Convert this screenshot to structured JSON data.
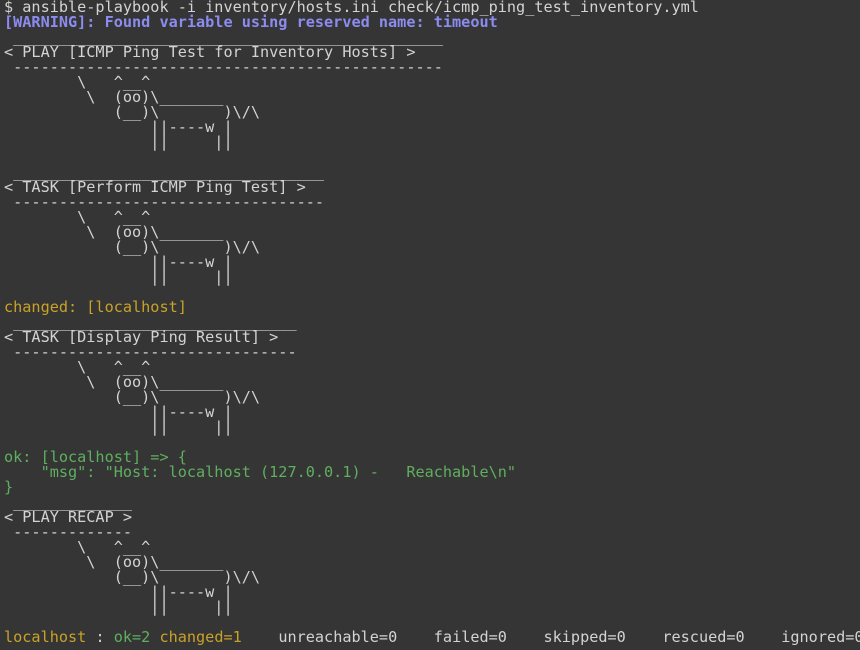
{
  "colors": {
    "background": "#353535",
    "default_text": "#d3d3d3",
    "warning": "#8c8cf0",
    "changed": "#c9a227",
    "ok": "#5faf5f"
  },
  "lines": [
    {
      "segments": [
        {
          "text": "$ ansible-playbook -i inventory/hosts.ini check/icmp_ping_test_inventory.yml",
          "style": "c-default"
        }
      ]
    },
    {
      "segments": [
        {
          "text": "[WARNING]: Found variable using reserved name: timeout",
          "style": "c-warn"
        }
      ]
    },
    {
      "segments": [
        {
          "text": " _______________________________________________",
          "style": "c-default"
        }
      ]
    },
    {
      "segments": [
        {
          "text": "< PLAY [ICMP Ping Test for Inventory Hosts] >",
          "style": "c-default"
        }
      ]
    },
    {
      "segments": [
        {
          "text": " -----------------------------------------------",
          "style": "c-default"
        }
      ]
    },
    {
      "segments": [
        {
          "text": "        \\   ^__^",
          "style": "c-default"
        }
      ]
    },
    {
      "segments": [
        {
          "text": "         \\  (oo)\\_______",
          "style": "c-default"
        }
      ]
    },
    {
      "segments": [
        {
          "text": "            (__)\\       )\\/\\",
          "style": "c-default"
        }
      ]
    },
    {
      "segments": [
        {
          "text": "                ||----w |",
          "style": "c-default"
        }
      ]
    },
    {
      "segments": [
        {
          "text": "                ||     ||",
          "style": "c-default"
        }
      ]
    },
    {
      "segments": [
        {
          "text": "",
          "style": "c-default"
        }
      ]
    },
    {
      "segments": [
        {
          "text": " __________________________________",
          "style": "c-default"
        }
      ]
    },
    {
      "segments": [
        {
          "text": "< TASK [Perform ICMP Ping Test] >",
          "style": "c-default"
        }
      ]
    },
    {
      "segments": [
        {
          "text": " ----------------------------------",
          "style": "c-default"
        }
      ]
    },
    {
      "segments": [
        {
          "text": "        \\   ^__^",
          "style": "c-default"
        }
      ]
    },
    {
      "segments": [
        {
          "text": "         \\  (oo)\\_______",
          "style": "c-default"
        }
      ]
    },
    {
      "segments": [
        {
          "text": "            (__)\\       )\\/\\",
          "style": "c-default"
        }
      ]
    },
    {
      "segments": [
        {
          "text": "                ||----w |",
          "style": "c-default"
        }
      ]
    },
    {
      "segments": [
        {
          "text": "                ||     ||",
          "style": "c-default"
        }
      ]
    },
    {
      "segments": [
        {
          "text": "",
          "style": "c-default"
        }
      ]
    },
    {
      "segments": [
        {
          "text": "changed: [localhost]",
          "style": "c-changed"
        }
      ]
    },
    {
      "segments": [
        {
          "text": " _______________________________",
          "style": "c-default"
        }
      ]
    },
    {
      "segments": [
        {
          "text": "< TASK [Display Ping Result] >",
          "style": "c-default"
        }
      ]
    },
    {
      "segments": [
        {
          "text": " -------------------------------",
          "style": "c-default"
        }
      ]
    },
    {
      "segments": [
        {
          "text": "        \\   ^__^",
          "style": "c-default"
        }
      ]
    },
    {
      "segments": [
        {
          "text": "         \\  (oo)\\_______",
          "style": "c-default"
        }
      ]
    },
    {
      "segments": [
        {
          "text": "            (__)\\       )\\/\\",
          "style": "c-default"
        }
      ]
    },
    {
      "segments": [
        {
          "text": "                ||----w |",
          "style": "c-default"
        }
      ]
    },
    {
      "segments": [
        {
          "text": "                ||     ||",
          "style": "c-default"
        }
      ]
    },
    {
      "segments": [
        {
          "text": "",
          "style": "c-default"
        }
      ]
    },
    {
      "segments": [
        {
          "text": "ok: [localhost] => {",
          "style": "c-ok"
        }
      ]
    },
    {
      "segments": [
        {
          "text": "    \"msg\": \"Host: localhost (127.0.0.1) -   Reachable\\n\"",
          "style": "c-ok"
        }
      ]
    },
    {
      "segments": [
        {
          "text": "}",
          "style": "c-ok"
        }
      ]
    },
    {
      "segments": [
        {
          "text": " _____________",
          "style": "c-default"
        }
      ]
    },
    {
      "segments": [
        {
          "text": "< PLAY RECAP >",
          "style": "c-default"
        }
      ]
    },
    {
      "segments": [
        {
          "text": " -------------",
          "style": "c-default"
        }
      ]
    },
    {
      "segments": [
        {
          "text": "        \\   ^__^",
          "style": "c-default"
        }
      ]
    },
    {
      "segments": [
        {
          "text": "         \\  (oo)\\_______",
          "style": "c-default"
        }
      ]
    },
    {
      "segments": [
        {
          "text": "            (__)\\       )\\/\\",
          "style": "c-default"
        }
      ]
    },
    {
      "segments": [
        {
          "text": "                ||----w |",
          "style": "c-default"
        }
      ]
    },
    {
      "segments": [
        {
          "text": "                ||     ||",
          "style": "c-default"
        }
      ]
    },
    {
      "segments": [
        {
          "text": "",
          "style": "c-default"
        }
      ]
    },
    {
      "segments": [
        {
          "text": "localhost",
          "style": "c-changed"
        },
        {
          "text": " : ",
          "style": "c-default"
        },
        {
          "text": "ok=2",
          "style": "c-ok"
        },
        {
          "text": " ",
          "style": "c-default"
        },
        {
          "text": "changed=1",
          "style": "c-changed"
        },
        {
          "text": "    unreachable=0    failed=0    skipped=0    rescued=0    ignored=0",
          "style": "c-default"
        }
      ]
    }
  ]
}
